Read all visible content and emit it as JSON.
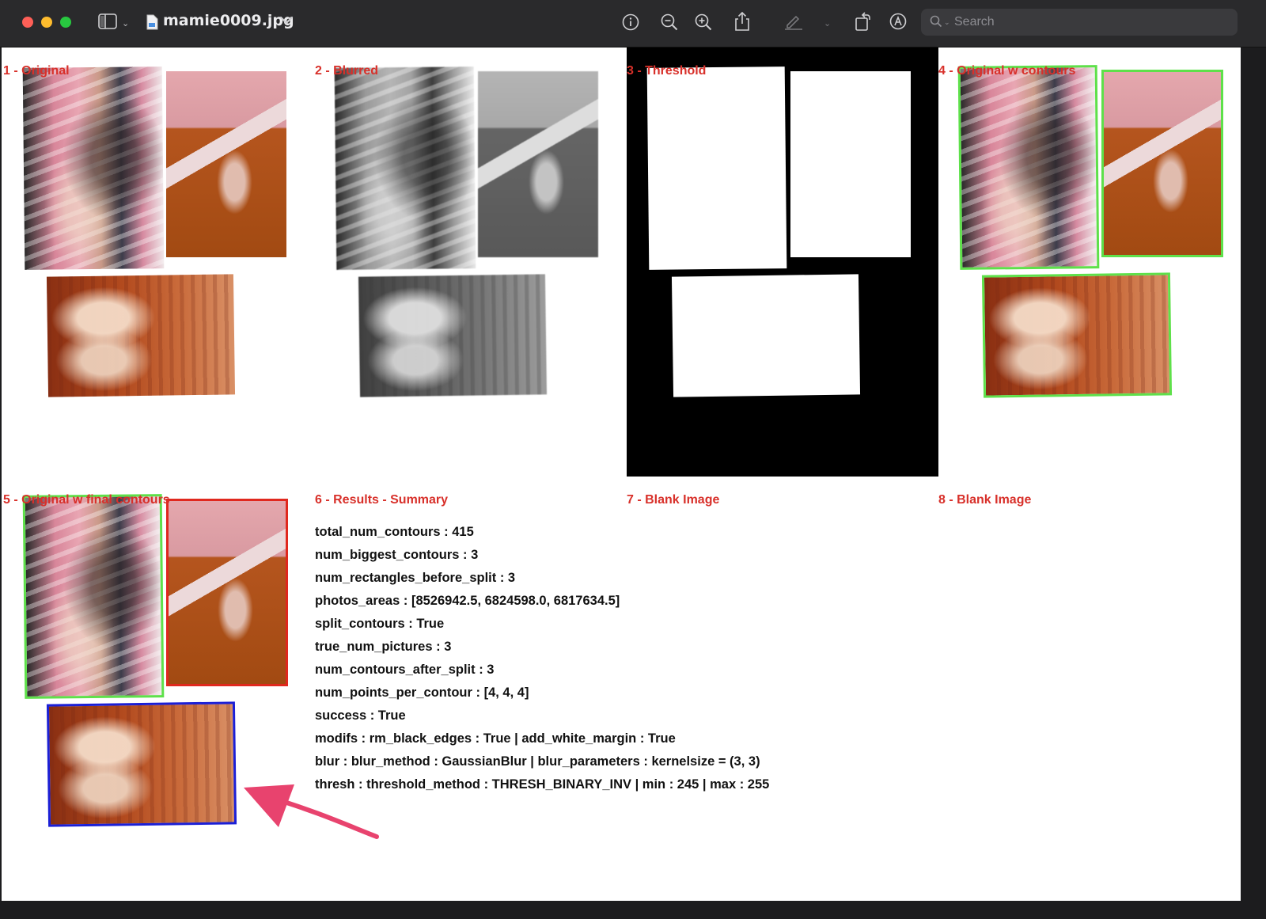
{
  "window": {
    "title": "mamie0009.jpg",
    "search_placeholder": "Search"
  },
  "panels": {
    "p1": "1 - Original",
    "p2": "2 - Blurred",
    "p3": "3 - Threshold",
    "p4": "4 - Original w contours",
    "p5": "5 - Original w final contours",
    "p6": "6 - Results - Summary",
    "p7": "7 - Blank Image",
    "p8": "8 - Blank Image"
  },
  "results": [
    "total_num_contours : 415",
    "num_biggest_contours : 3",
    "num_rectangles_before_split : 3",
    "photos_areas : [8526942.5, 6824598.0, 6817634.5]",
    "split_contours : True",
    "true_num_pictures : 3",
    "num_contours_after_split : 3",
    "num_points_per_contour : [4, 4, 4]",
    "success : True",
    "modifs : rm_black_edges : True | add_white_margin : True",
    "blur : blur_method : GaussianBlur | blur_parameters : kernelsize = (3, 3)",
    "thresh : threshold_method  : THRESH_BINARY_INV | min :  245 | max :  255"
  ],
  "colors": {
    "label_red": "#d8302a",
    "contour_green": "#5ee04a",
    "contour_red": "#e0281e",
    "contour_blue": "#1b1fd6",
    "arrow_pink": "#e8436e"
  },
  "icons": [
    "sidebar-toggle-icon",
    "file-icon",
    "info-icon",
    "zoom-out-icon",
    "zoom-in-icon",
    "share-icon",
    "highlight-pen-icon",
    "rotate-icon",
    "markup-icon",
    "search-icon"
  ]
}
